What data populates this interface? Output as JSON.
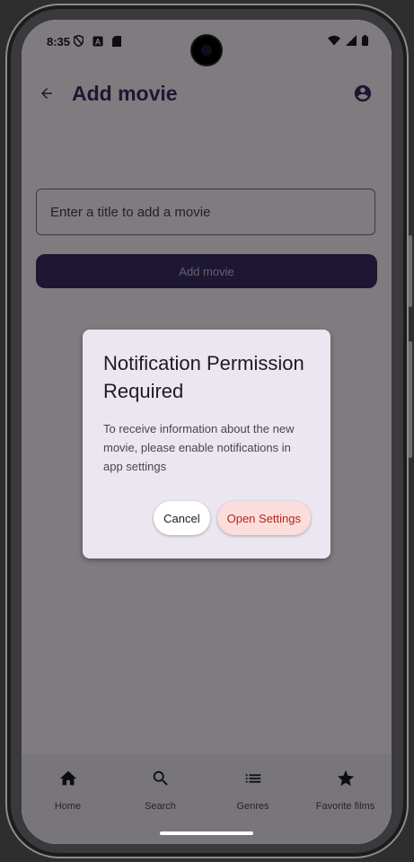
{
  "status_bar": {
    "time": "8:35",
    "left_icons": [
      "shield-icon",
      "a-notification-icon",
      "sd-card-icon"
    ],
    "right_icons": [
      "wifi-icon",
      "signal-icon",
      "battery-icon"
    ]
  },
  "app_bar": {
    "title": "Add movie",
    "back_icon": "arrow-back-icon",
    "account_icon": "account-circle-icon"
  },
  "form": {
    "title_placeholder": "Enter a title to add a movie",
    "add_button_label": "Add movie"
  },
  "dialog": {
    "title": "Notification Permission Required",
    "message": "To receive information about the new movie, please enable notifications in app settings",
    "cancel_label": "Cancel",
    "open_settings_label": "Open Settings"
  },
  "bottom_nav": {
    "items": [
      {
        "label": "Home",
        "icon": "home-icon"
      },
      {
        "label": "Search",
        "icon": "search-icon"
      },
      {
        "label": "Genres",
        "icon": "list-icon"
      },
      {
        "label": "Favorite films",
        "icon": "star-icon"
      }
    ]
  },
  "colors": {
    "primary": "#3b2f66",
    "surface": "#fef7ff",
    "dialog_surface": "#ece6f0",
    "error_text": "#b3261e",
    "error_container": "#fbdedc"
  }
}
